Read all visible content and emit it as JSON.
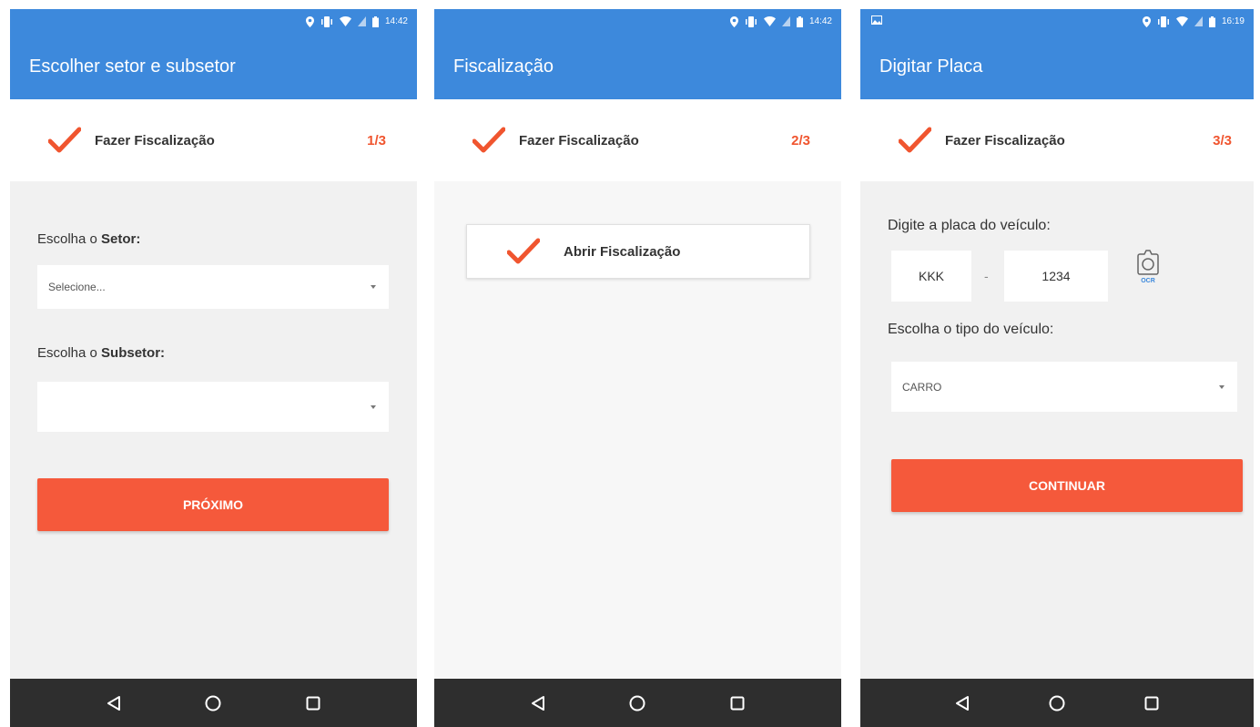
{
  "colors": {
    "primary": "#3d89dc",
    "accent": "#f5593b",
    "step_count": "#f0552f",
    "navbar": "#2e2e2e",
    "background": "#f1f1f1"
  },
  "screens": [
    {
      "status_time": "14:42",
      "title": "Escolher setor e subsetor",
      "step_label": "Fazer Fiscalização",
      "step_count": "1/3",
      "setor_label_prefix": "Escolha o ",
      "setor_label_bold": "Setor:",
      "setor_value": "Selecione...",
      "subsetor_label_prefix": "Escolha o ",
      "subsetor_label_bold": "Subsetor:",
      "subsetor_value": "",
      "button": "PRÓXIMO"
    },
    {
      "status_time": "14:42",
      "title": "Fiscalização",
      "step_label": "Fazer Fiscalização",
      "step_count": "2/3",
      "card_label": "Abrir Fiscalização"
    },
    {
      "status_time": "16:19",
      "title": "Digitar Placa",
      "step_label": "Fazer Fiscalização",
      "step_count": "3/3",
      "plate_label": "Digite a placa do veículo:",
      "plate_letters": "KKK",
      "plate_separator": "-",
      "plate_numbers": "1234",
      "ocr_label": "OCR",
      "vehicle_type_label": "Escolha o tipo do veículo:",
      "vehicle_type_value": "CARRO",
      "button": "CONTINUAR"
    }
  ],
  "icons": {
    "status": [
      "location-icon",
      "vibrate-icon",
      "wifi-icon",
      "signal-icon",
      "battery-icon"
    ],
    "step": "check-icon",
    "camera": "camera-icon",
    "nav": [
      "back-icon",
      "home-icon",
      "recents-icon"
    ]
  }
}
